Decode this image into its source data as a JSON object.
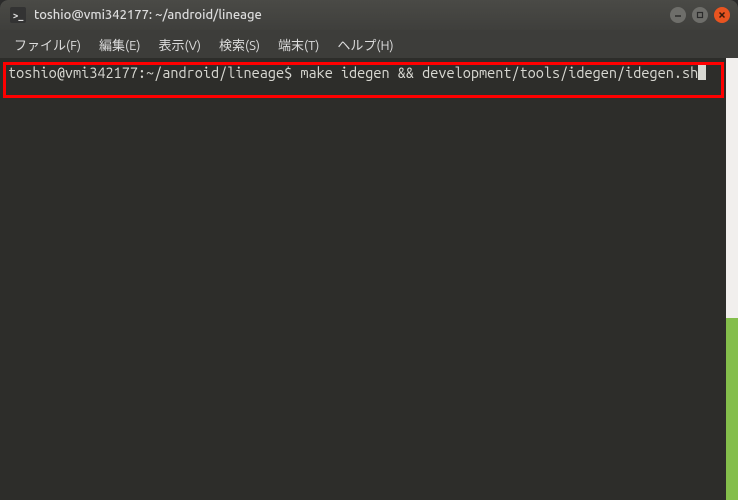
{
  "titlebar": {
    "title": "toshio@vmi342177: ~/android/lineage"
  },
  "menubar": {
    "file": "ファイル(F)",
    "edit": "編集(E)",
    "view": "表示(V)",
    "search": "検索(S)",
    "terminal": "端末(T)",
    "help": "ヘルプ(H)"
  },
  "terminal": {
    "prompt": "toshio@vmi342177:~/android/lineage$",
    "command": "make idegen && development/tools/idegen/idegen.sh"
  }
}
